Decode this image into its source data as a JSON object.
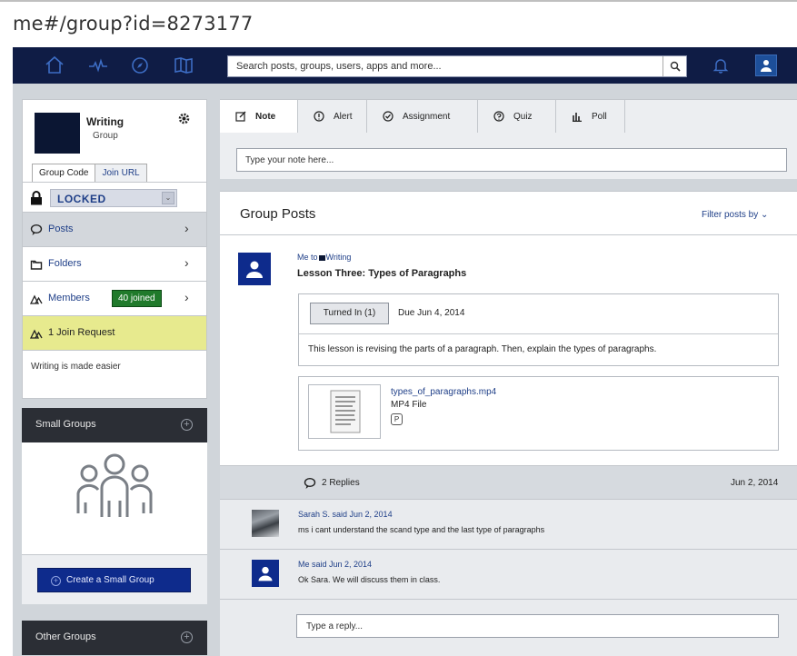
{
  "browser": {
    "url": "me#/group?id=8273177"
  },
  "topnav": {
    "search_placeholder": "Search posts, groups, users, apps and more...",
    "icons": [
      "home-icon",
      "activity-icon",
      "discover-icon",
      "library-icon",
      "search-icon",
      "bell-icon",
      "user-icon"
    ]
  },
  "group": {
    "name": "Writing",
    "type": "Group",
    "tabs": [
      "Group Code",
      "Join URL"
    ],
    "lock_status": "LOCKED",
    "menu": {
      "posts": "Posts",
      "folders": "Folders",
      "members": "Members",
      "members_badge": "40 joined",
      "join_request": "1 Join Request"
    },
    "tagline": "Writing is made easier"
  },
  "small_groups": {
    "title": "Small Groups",
    "create_label": "Create a Small Group"
  },
  "other_groups": {
    "title": "Other Groups"
  },
  "composer": {
    "tabs": [
      {
        "label": "Note",
        "icon": "note-icon"
      },
      {
        "label": "Alert",
        "icon": "alert-icon"
      },
      {
        "label": "Assignment",
        "icon": "assignment-icon"
      },
      {
        "label": "Quiz",
        "icon": "quiz-icon"
      },
      {
        "label": "Poll",
        "icon": "poll-icon"
      }
    ],
    "placeholder": "Type your note here..."
  },
  "posts": {
    "title": "Group Posts",
    "filter_label": "Filter posts by",
    "post": {
      "from": "Me",
      "to_word": "to",
      "group": "Writing",
      "title": "Lesson Three: Types of Paragraphs",
      "turned_in": "Turned In (1)",
      "due": "Due Jun 4, 2014",
      "description": "This lesson is revising the parts of a paragraph. Then, explain the types of paragraphs.",
      "file_name": "types_of_paragraphs.mp4",
      "file_type": "MP4 File",
      "file_badge": "P",
      "replies_label": "2 Replies",
      "date": "Jun 2, 2014"
    },
    "replies": [
      {
        "meta": "Sarah S. said Jun 2, 2014",
        "text": "ms i cant understand the scand type and the last type of paragraphs"
      },
      {
        "meta": "Me said Jun 2, 2014",
        "text": "Ok Sara. We will discuss them in class."
      }
    ],
    "reply_placeholder": "Type a reply..."
  },
  "colors": {
    "nav_bg": "#0f1c45",
    "accent": "#0e2b8c",
    "members_badge": "#207a2b",
    "join_request_bg": "#e7ea8e",
    "panel_dark": "#2b2e35"
  }
}
